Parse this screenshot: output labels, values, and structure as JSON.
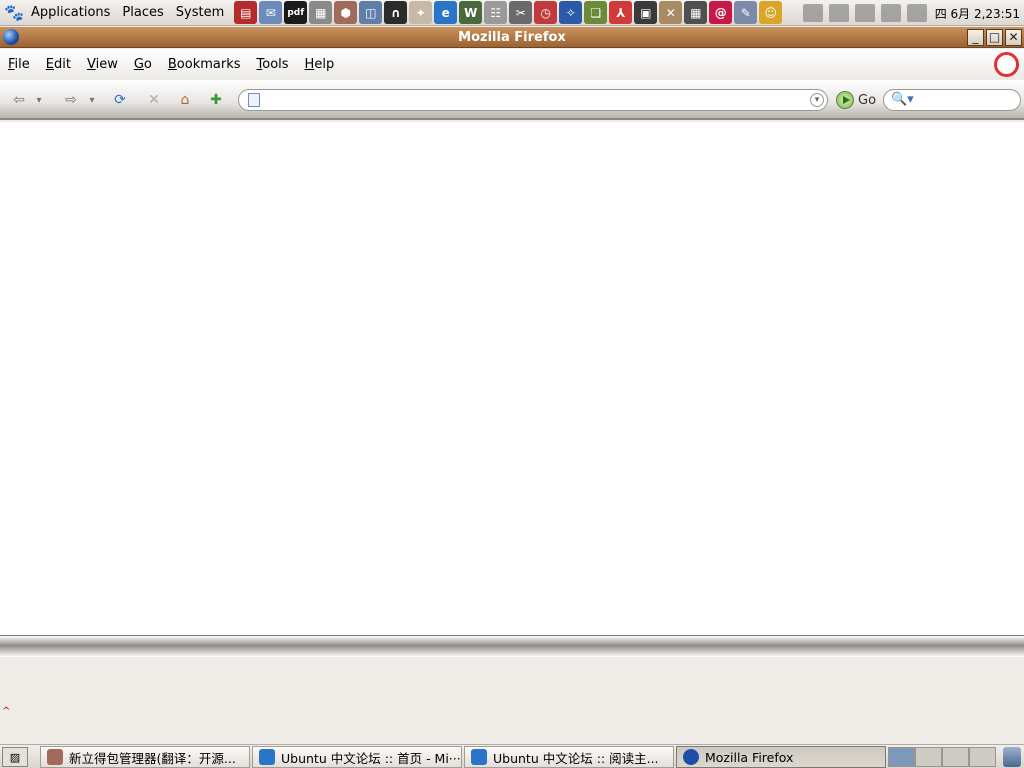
{
  "top_panel": {
    "menus": [
      "Applications",
      "Places",
      "System"
    ],
    "launchers": [
      {
        "icon": "books-icon",
        "color": "#b52a2a",
        "glyph": "▤"
      },
      {
        "icon": "mail-icon",
        "color": "#6b8bbd",
        "glyph": "✉"
      },
      {
        "icon": "pdf-icon",
        "color": "#1a1a1a",
        "glyph": "pdf"
      },
      {
        "icon": "cabinet-icon",
        "color": "#8a8a8a",
        "glyph": "▦"
      },
      {
        "icon": "package-icon",
        "color": "#a06a5c",
        "glyph": "⬢"
      },
      {
        "icon": "screenshot-icon",
        "color": "#5f7ea8",
        "glyph": "◫"
      },
      {
        "icon": "terminal-dark-icon",
        "color": "#2b2b2b",
        "glyph": "∩"
      },
      {
        "icon": "media-icon",
        "color": "#c8b9a6",
        "glyph": "✦"
      },
      {
        "icon": "ie-icon",
        "color": "#2a74c9",
        "glyph": "e"
      },
      {
        "icon": "monitor-icon",
        "color": "#4b6a3c",
        "glyph": "W"
      },
      {
        "icon": "spreadsheet-icon",
        "color": "#9a9a9a",
        "glyph": "☷"
      },
      {
        "icon": "tool-icon",
        "color": "#6a6a6a",
        "glyph": "✂"
      },
      {
        "icon": "clock-icon",
        "color": "#c03b3b",
        "glyph": "◷"
      },
      {
        "icon": "wizard-icon",
        "color": "#2a5aa8",
        "glyph": "✧"
      },
      {
        "icon": "book-icon",
        "color": "#6b8a3a",
        "glyph": "❏"
      },
      {
        "icon": "acrobat-icon",
        "color": "#d23a3a",
        "glyph": "⅄"
      },
      {
        "icon": "console-icon",
        "color": "#3a3a3a",
        "glyph": "▣"
      },
      {
        "icon": "gimp-icon",
        "color": "#a88a64",
        "glyph": "✕"
      },
      {
        "icon": "calculator-icon",
        "color": "#505050",
        "glyph": "▦"
      },
      {
        "icon": "debian-icon",
        "color": "#c8184a",
        "glyph": "@"
      },
      {
        "icon": "compass-icon",
        "color": "#7a8aa8",
        "glyph": "✎"
      },
      {
        "icon": "messenger-icon",
        "color": "#d9a628",
        "glyph": "☺"
      }
    ],
    "clock": "四 6月 2,23:51"
  },
  "window": {
    "title": "Mozilla Firefox",
    "buttons": {
      "minimize": "_",
      "maximize": "□",
      "close": "✕"
    }
  },
  "menubar": {
    "items": [
      {
        "accel": "F",
        "rest": "ile"
      },
      {
        "accel": "E",
        "rest": "dit"
      },
      {
        "accel": "V",
        "rest": "iew"
      },
      {
        "accel": "G",
        "rest": "o"
      },
      {
        "accel": "B",
        "rest": "ookmarks"
      },
      {
        "accel": "T",
        "rest": "ools"
      },
      {
        "accel": "H",
        "rest": "elp"
      }
    ]
  },
  "navbar": {
    "url_value": "",
    "go_label": "Go",
    "search_value": ""
  },
  "taskbar": {
    "tasks": [
      {
        "label": "新立得包管理器(翻译：开源...",
        "icon_color": "#a06a5c",
        "active": false
      },
      {
        "label": "Ubuntu 中文论坛 :: 首页 - Mi···",
        "icon_color": "#2a74c9",
        "active": false
      },
      {
        "label": "Ubuntu 中文论坛 :: 阅读主...",
        "icon_color": "#2a74c9",
        "active": false
      },
      {
        "label": "Mozilla Firefox",
        "icon_color": "#1d4fa8",
        "active": true
      }
    ]
  },
  "status": {
    "caret": "^"
  }
}
